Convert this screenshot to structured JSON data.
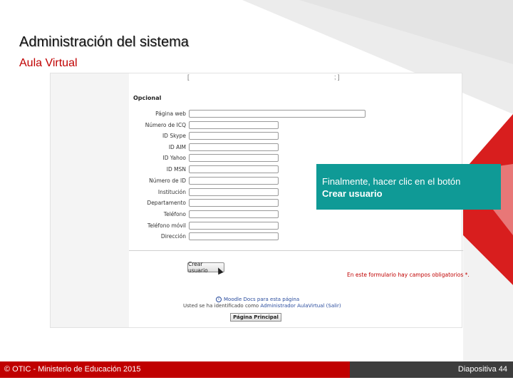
{
  "slide": {
    "title": "Administración del sistema",
    "subtitle": "Aula Virtual"
  },
  "screenshot": {
    "top_fragment_left": "[",
    "top_fragment_right": "; ]",
    "section_title": "Opcional",
    "fields": [
      {
        "label": "Página web",
        "value": ""
      },
      {
        "label": "Número de ICQ",
        "value": ""
      },
      {
        "label": "ID Skype",
        "value": ""
      },
      {
        "label": "ID AIM",
        "value": ""
      },
      {
        "label": "ID Yahoo",
        "value": ""
      },
      {
        "label": "ID MSN",
        "value": ""
      },
      {
        "label": "Número de ID",
        "value": ""
      },
      {
        "label": "Institución",
        "value": ""
      },
      {
        "label": "Departamento",
        "value": ""
      },
      {
        "label": "Teléfono",
        "value": ""
      },
      {
        "label": "Teléfono móvil",
        "value": ""
      },
      {
        "label": "Dirección",
        "value": ""
      }
    ],
    "create_button": "Crear usuario",
    "required_note": "En este formulario hay campos obligatorios *.",
    "docs_link": "Moodle Docs para esta página",
    "logged_prefix": "Usted se ha identificado como",
    "logged_user": "Administrador AulaVirtual",
    "logout_link": "(Salir)",
    "home_button": "Página Principal"
  },
  "callout": {
    "line1": "Finalmente, hacer clic en el botón",
    "line2": "Crear usuario"
  },
  "footer": {
    "left": "© OTIC - Ministerio de Educación 2015",
    "right": "Diapositiva 44"
  }
}
